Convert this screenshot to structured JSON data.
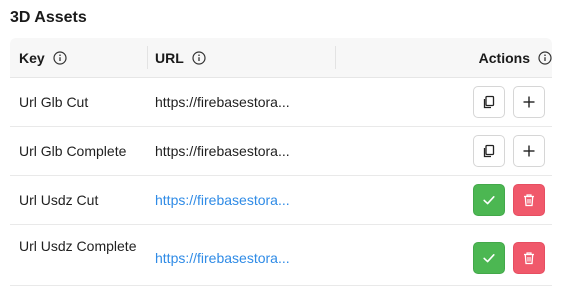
{
  "section": {
    "title": "3D Assets"
  },
  "table": {
    "headers": {
      "key": "Key",
      "url": "URL",
      "actions": "Actions"
    },
    "rows": [
      {
        "key": "Url Glb Cut",
        "url": "https://firebasestora...",
        "url_state": "plain",
        "actions": [
          "copy",
          "add"
        ]
      },
      {
        "key": "Url Glb Complete",
        "url": "https://firebasestora...",
        "url_state": "plain",
        "actions": [
          "copy",
          "add"
        ]
      },
      {
        "key": "Url Usdz Cut",
        "url": "https://firebasestora...",
        "url_state": "link",
        "actions": [
          "confirm",
          "delete"
        ]
      },
      {
        "key": "Url Usdz Complete",
        "url": "https://firebasestora...",
        "url_state": "link",
        "actions": [
          "confirm",
          "delete"
        ]
      }
    ]
  },
  "colors": {
    "link": "#2f8be6",
    "confirm_button": "#4cb752",
    "delete_button": "#f0596b",
    "header_background": "#f7f7f7"
  },
  "icons": {
    "header_info": "info-circle-icon",
    "copy": "copy-icon",
    "add": "plus-icon",
    "confirm": "check-icon",
    "delete": "trash-icon"
  }
}
